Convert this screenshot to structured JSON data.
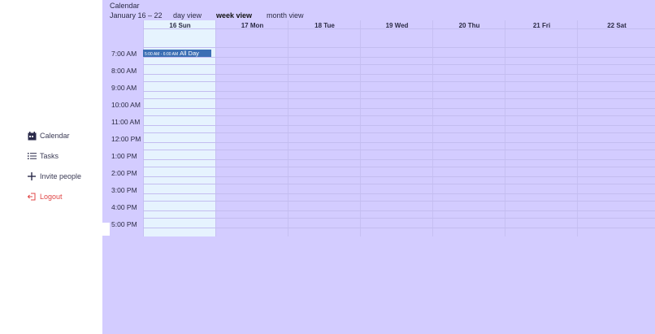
{
  "sidebar": {
    "items": [
      {
        "label": "Calendar",
        "icon": "calendar-icon"
      },
      {
        "label": "Tasks",
        "icon": "list-icon"
      },
      {
        "label": "Invite people",
        "icon": "plus-icon"
      },
      {
        "label": "Logout",
        "icon": "logout-icon"
      }
    ]
  },
  "header": {
    "title": "Calendar",
    "range": "January 16 – 22",
    "views": [
      "day view",
      "week view",
      "month view"
    ],
    "active_view": "week view"
  },
  "days": [
    "16 Sun",
    "17 Mon",
    "18 Tue",
    "19 Wed",
    "20 Thu",
    "21 Fri",
    "22 Sat"
  ],
  "times": [
    "7:00 AM",
    "8:00 AM",
    "9:00 AM",
    "10:00 AM",
    "11:00 AM",
    "12:00 PM",
    "1:00 PM",
    "2:00 PM",
    "3:00 PM",
    "4:00 PM",
    "5:00 PM"
  ],
  "event": {
    "time": "5:00 AM - 6:00 AM",
    "title": "All Day"
  },
  "colors": {
    "main_bg": "#d3ccff",
    "today_bg": "#e6f3fe",
    "event_bg": "#3b6fb4",
    "logout": "#e04646"
  }
}
